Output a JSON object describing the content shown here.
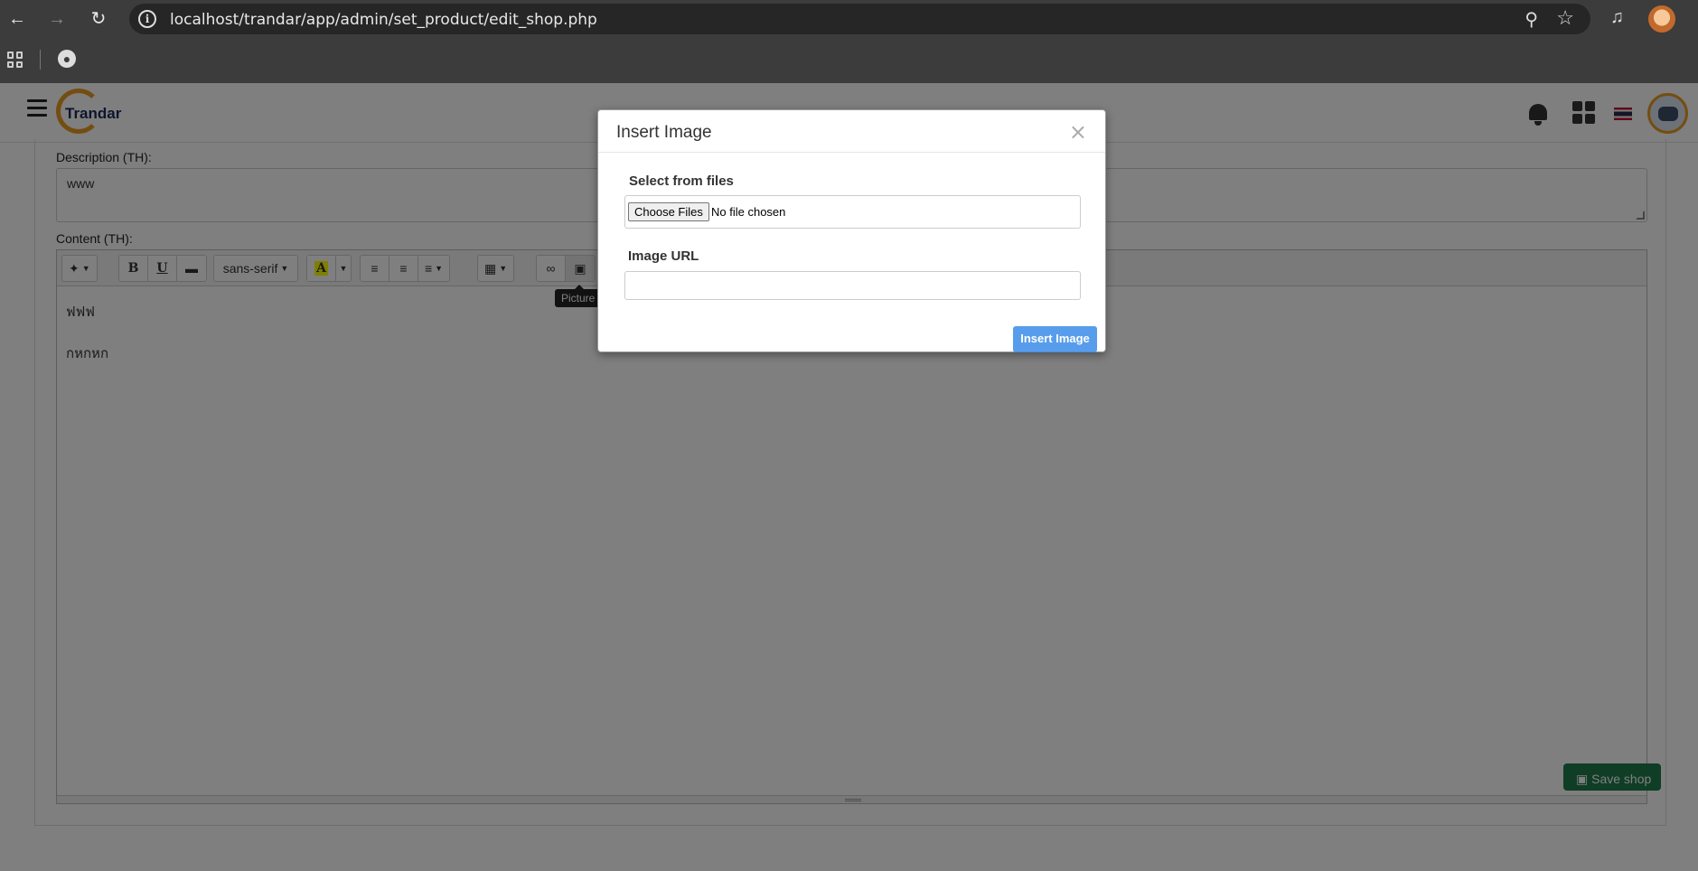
{
  "browser": {
    "url": "localhost/trandar/app/admin/set_product/edit_shop.php"
  },
  "app": {
    "logo_text": "Trandar",
    "header_subtitle": ""
  },
  "form": {
    "description_label": "Description (TH):",
    "description_value": "www",
    "content_label": "Content (TH):",
    "content_lines": [
      "ฟฟฟ",
      "กหกหก"
    ],
    "save_label": "Save shop"
  },
  "toolbar": {
    "font_name": "sans-serif",
    "bold": "B",
    "underline": "U",
    "tooltip": "Picture"
  },
  "modal": {
    "title": "Insert Image",
    "close": "×",
    "select_label": "Select from files",
    "choose_files": "Choose Files",
    "no_file": "No file chosen",
    "url_label": "Image URL",
    "url_value": "",
    "insert_label": "Insert Image"
  },
  "colors": {
    "accent": "#3c8de8",
    "brand": "#e89b22",
    "save": "#1f7a4a"
  }
}
